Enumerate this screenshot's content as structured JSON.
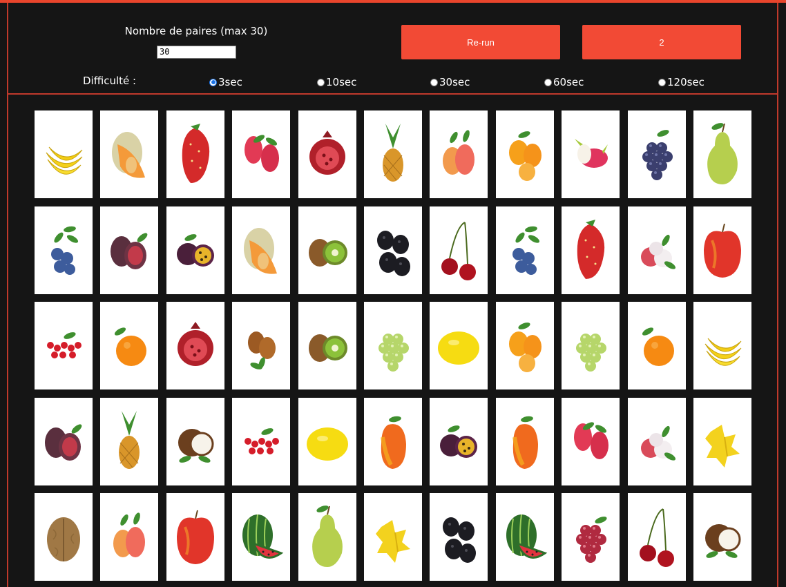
{
  "settings": {
    "pairs_label": "Nombre de paires (max 30)",
    "pairs_value": "30",
    "rerun_label": "Re-run",
    "count_label": "2",
    "difficulty_label": "Difficulté :",
    "difficulty_options": [
      "3sec",
      "10sec",
      "30sec",
      "60sec",
      "120sec"
    ],
    "difficulty_selected": "3sec"
  },
  "colors": {
    "accent": "#f24a35",
    "border": "#c0392b",
    "background": "#151515"
  },
  "board": {
    "columns": 11,
    "rows": [
      [
        "banana",
        "cantaloupe",
        "strawberry",
        "raspberry",
        "pomegranate",
        "pineapple",
        "peach",
        "kumquat",
        "dragonfruit",
        "grapes-purple",
        "pear"
      ],
      [
        "blueberry",
        "fig",
        "passionfruit",
        "cantaloupe",
        "kiwi",
        "blackberry",
        "cherry",
        "blueberry",
        "strawberry",
        "lychee",
        "apple"
      ],
      [
        "redcurrant",
        "orange",
        "pomegranate",
        "hazelnut",
        "kiwi",
        "grapes-green",
        "lemon",
        "kumquat",
        "grapes-green",
        "orange",
        "banana"
      ],
      [
        "fig",
        "pineapple",
        "coconut",
        "redcurrant",
        "lemon",
        "mango",
        "passionfruit",
        "mango",
        "raspberry",
        "lychee",
        "starfruit"
      ],
      [
        "walnut",
        "peach",
        "apple",
        "watermelon",
        "pear",
        "starfruit",
        "blackberry",
        "watermelon",
        "grapes-red",
        "cherry",
        "coconut"
      ]
    ]
  }
}
